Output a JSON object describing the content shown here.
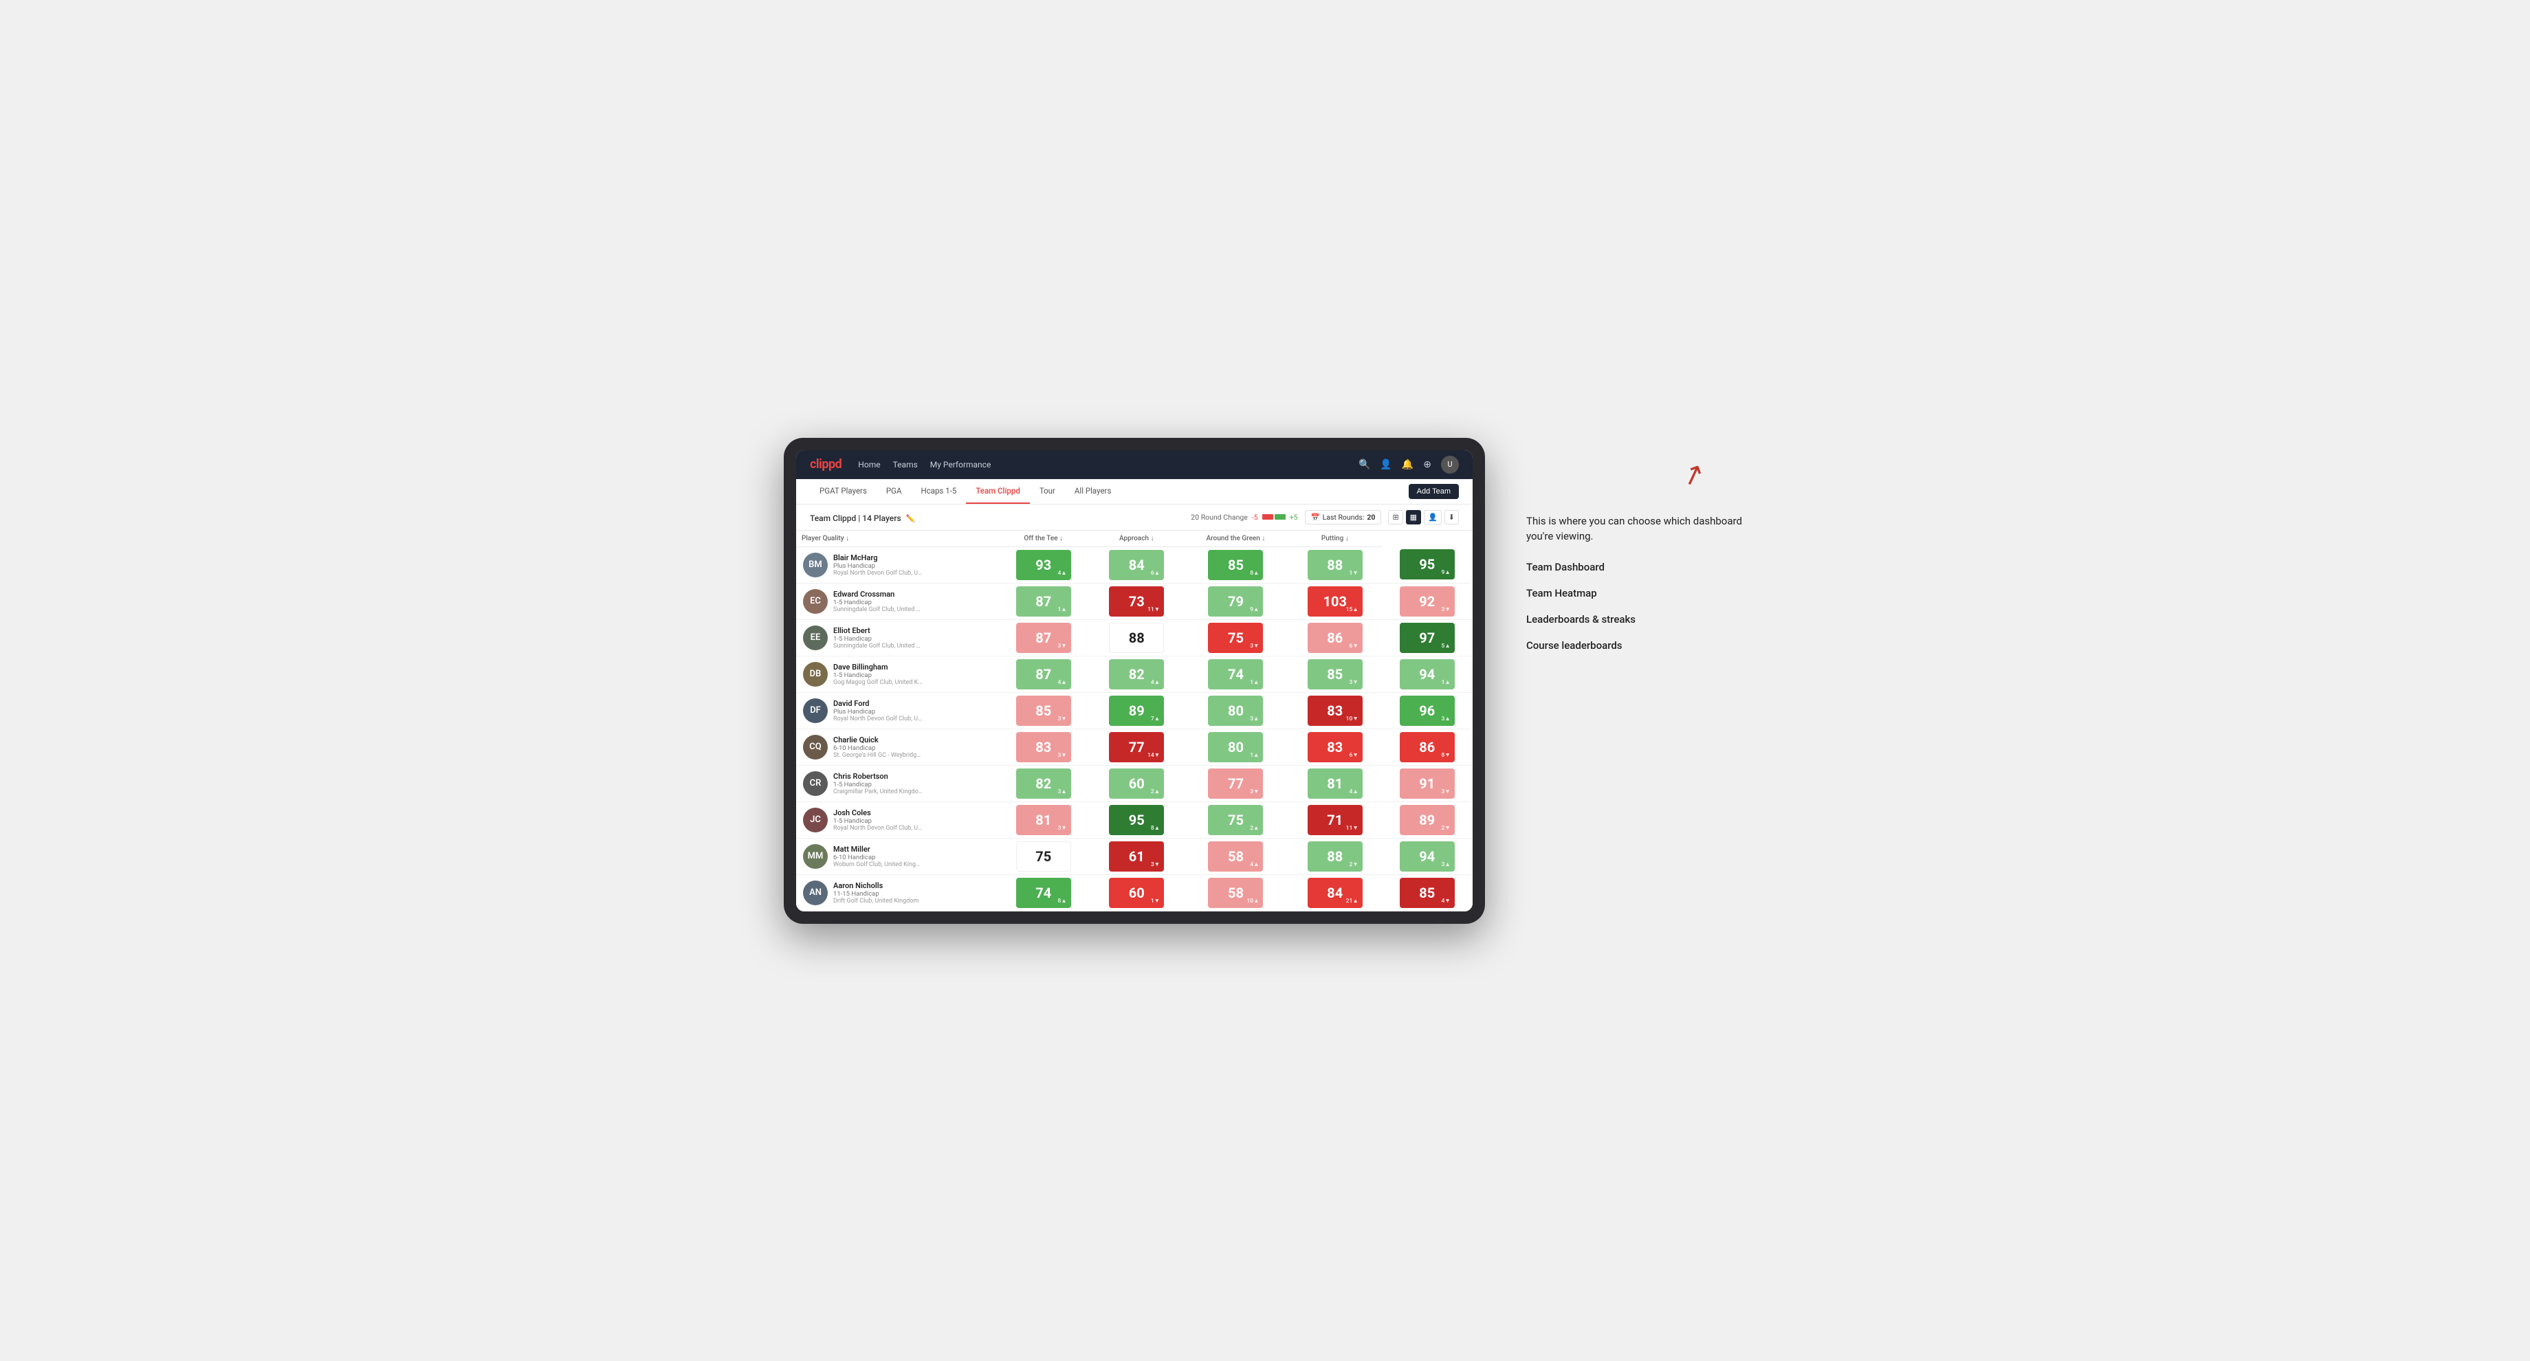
{
  "logo": "clippd",
  "nav": {
    "links": [
      "Home",
      "Teams",
      "My Performance"
    ],
    "icons": [
      "🔍",
      "👤",
      "🔔",
      "⊕",
      "👤"
    ]
  },
  "sub_nav": {
    "tabs": [
      {
        "label": "PGAT Players",
        "active": false
      },
      {
        "label": "PGA",
        "active": false
      },
      {
        "label": "Hcaps 1-5",
        "active": false
      },
      {
        "label": "Team Clippd",
        "active": true
      },
      {
        "label": "Tour",
        "active": false
      },
      {
        "label": "All Players",
        "active": false
      }
    ],
    "add_team_label": "Add Team"
  },
  "team_header": {
    "title": "Team Clippd",
    "player_count": "14 Players",
    "round_change_label": "20 Round Change",
    "change_neg": "-5",
    "change_pos": "+5",
    "last_rounds_label": "Last Rounds:",
    "last_rounds_value": "20"
  },
  "table": {
    "columns": [
      {
        "label": "Player Quality ↓",
        "key": "player_quality"
      },
      {
        "label": "Off the Tee ↓",
        "key": "off_tee"
      },
      {
        "label": "Approach ↓",
        "key": "approach"
      },
      {
        "label": "Around the Green ↓",
        "key": "around_green"
      },
      {
        "label": "Putting ↓",
        "key": "putting"
      }
    ],
    "rows": [
      {
        "name": "Blair McHarg",
        "handicap": "Plus Handicap",
        "club": "Royal North Devon Golf Club, United Kingdom",
        "avatar_color": "#6b7c8d",
        "avatar_initials": "BM",
        "scores": [
          {
            "value": "93",
            "change": "4▲",
            "change_dir": "up",
            "bg": "bg-green-mid"
          },
          {
            "value": "84",
            "change": "6▲",
            "change_dir": "up",
            "bg": "bg-green-light"
          },
          {
            "value": "85",
            "change": "8▲",
            "change_dir": "up",
            "bg": "bg-green-mid"
          },
          {
            "value": "88",
            "change": "1▼",
            "change_dir": "down",
            "bg": "bg-green-light"
          },
          {
            "value": "95",
            "change": "9▲",
            "change_dir": "up",
            "bg": "bg-green-dark"
          }
        ]
      },
      {
        "name": "Edward Crossman",
        "handicap": "1-5 Handicap",
        "club": "Sunningdale Golf Club, United Kingdom",
        "avatar_color": "#8b6b5d",
        "avatar_initials": "EC",
        "scores": [
          {
            "value": "87",
            "change": "1▲",
            "change_dir": "up",
            "bg": "bg-green-light"
          },
          {
            "value": "73",
            "change": "11▼",
            "change_dir": "down",
            "bg": "bg-red-dark"
          },
          {
            "value": "79",
            "change": "9▲",
            "change_dir": "up",
            "bg": "bg-green-light"
          },
          {
            "value": "103",
            "change": "15▲",
            "change_dir": "up",
            "bg": "bg-red-mid"
          },
          {
            "value": "92",
            "change": "3▼",
            "change_dir": "down",
            "bg": "bg-red-light"
          }
        ]
      },
      {
        "name": "Elliot Ebert",
        "handicap": "1-5 Handicap",
        "club": "Sunningdale Golf Club, United Kingdom",
        "avatar_color": "#5d6b5d",
        "avatar_initials": "EE",
        "scores": [
          {
            "value": "87",
            "change": "3▼",
            "change_dir": "down",
            "bg": "bg-red-light"
          },
          {
            "value": "88",
            "change": "",
            "change_dir": "",
            "bg": "bg-white"
          },
          {
            "value": "75",
            "change": "3▼",
            "change_dir": "down",
            "bg": "bg-red-mid"
          },
          {
            "value": "86",
            "change": "6▼",
            "change_dir": "down",
            "bg": "bg-red-light"
          },
          {
            "value": "97",
            "change": "5▲",
            "change_dir": "up",
            "bg": "bg-green-dark"
          }
        ]
      },
      {
        "name": "Dave Billingham",
        "handicap": "1-5 Handicap",
        "club": "Gog Magog Golf Club, United Kingdom",
        "avatar_color": "#7a6b4a",
        "avatar_initials": "DB",
        "scores": [
          {
            "value": "87",
            "change": "4▲",
            "change_dir": "up",
            "bg": "bg-green-light"
          },
          {
            "value": "82",
            "change": "4▲",
            "change_dir": "up",
            "bg": "bg-green-light"
          },
          {
            "value": "74",
            "change": "1▲",
            "change_dir": "up",
            "bg": "bg-green-light"
          },
          {
            "value": "85",
            "change": "3▼",
            "change_dir": "down",
            "bg": "bg-green-light"
          },
          {
            "value": "94",
            "change": "1▲",
            "change_dir": "up",
            "bg": "bg-green-light"
          }
        ]
      },
      {
        "name": "David Ford",
        "handicap": "Plus Handicap",
        "club": "Royal North Devon Golf Club, United Kingdom",
        "avatar_color": "#4a5a6a",
        "avatar_initials": "DF",
        "scores": [
          {
            "value": "85",
            "change": "3▼",
            "change_dir": "down",
            "bg": "bg-red-light"
          },
          {
            "value": "89",
            "change": "7▲",
            "change_dir": "up",
            "bg": "bg-green-mid"
          },
          {
            "value": "80",
            "change": "3▲",
            "change_dir": "up",
            "bg": "bg-green-light"
          },
          {
            "value": "83",
            "change": "10▼",
            "change_dir": "down",
            "bg": "bg-red-dark"
          },
          {
            "value": "96",
            "change": "3▲",
            "change_dir": "up",
            "bg": "bg-green-mid"
          }
        ]
      },
      {
        "name": "Charlie Quick",
        "handicap": "6-10 Handicap",
        "club": "St. George's Hill GC - Weybridge - Surrey, Uni...",
        "avatar_color": "#6a5a4a",
        "avatar_initials": "CQ",
        "scores": [
          {
            "value": "83",
            "change": "3▼",
            "change_dir": "down",
            "bg": "bg-red-light"
          },
          {
            "value": "77",
            "change": "14▼",
            "change_dir": "down",
            "bg": "bg-red-dark"
          },
          {
            "value": "80",
            "change": "1▲",
            "change_dir": "up",
            "bg": "bg-green-light"
          },
          {
            "value": "83",
            "change": "6▼",
            "change_dir": "down",
            "bg": "bg-red-mid"
          },
          {
            "value": "86",
            "change": "8▼",
            "change_dir": "down",
            "bg": "bg-red-mid"
          }
        ]
      },
      {
        "name": "Chris Robertson",
        "handicap": "1-5 Handicap",
        "club": "Craigmillar Park, United Kingdom",
        "avatar_color": "#5a5a5a",
        "avatar_initials": "CR",
        "scores": [
          {
            "value": "82",
            "change": "3▲",
            "change_dir": "up",
            "bg": "bg-green-light"
          },
          {
            "value": "60",
            "change": "2▲",
            "change_dir": "up",
            "bg": "bg-green-light"
          },
          {
            "value": "77",
            "change": "3▼",
            "change_dir": "down",
            "bg": "bg-red-light"
          },
          {
            "value": "81",
            "change": "4▲",
            "change_dir": "up",
            "bg": "bg-green-light"
          },
          {
            "value": "91",
            "change": "3▼",
            "change_dir": "down",
            "bg": "bg-red-light"
          }
        ]
      },
      {
        "name": "Josh Coles",
        "handicap": "1-5 Handicap",
        "club": "Royal North Devon Golf Club, United Kingdom",
        "avatar_color": "#7a4a4a",
        "avatar_initials": "JC",
        "scores": [
          {
            "value": "81",
            "change": "3▼",
            "change_dir": "down",
            "bg": "bg-red-light"
          },
          {
            "value": "95",
            "change": "8▲",
            "change_dir": "up",
            "bg": "bg-green-dark"
          },
          {
            "value": "75",
            "change": "2▲",
            "change_dir": "up",
            "bg": "bg-green-light"
          },
          {
            "value": "71",
            "change": "11▼",
            "change_dir": "down",
            "bg": "bg-red-dark"
          },
          {
            "value": "89",
            "change": "2▼",
            "change_dir": "down",
            "bg": "bg-red-light"
          }
        ]
      },
      {
        "name": "Matt Miller",
        "handicap": "6-10 Handicap",
        "club": "Woburn Golf Club, United Kingdom",
        "avatar_color": "#6a7a5a",
        "avatar_initials": "MM",
        "scores": [
          {
            "value": "75",
            "change": "",
            "change_dir": "",
            "bg": "bg-white"
          },
          {
            "value": "61",
            "change": "3▼",
            "change_dir": "down",
            "bg": "bg-red-dark"
          },
          {
            "value": "58",
            "change": "4▲",
            "change_dir": "up",
            "bg": "bg-red-light"
          },
          {
            "value": "88",
            "change": "2▼",
            "change_dir": "down",
            "bg": "bg-green-light"
          },
          {
            "value": "94",
            "change": "3▲",
            "change_dir": "up",
            "bg": "bg-green-light"
          }
        ]
      },
      {
        "name": "Aaron Nicholls",
        "handicap": "11-15 Handicap",
        "club": "Drift Golf Club, United Kingdom",
        "avatar_color": "#5a6a7a",
        "avatar_initials": "AN",
        "scores": [
          {
            "value": "74",
            "change": "8▲",
            "change_dir": "up",
            "bg": "bg-green-mid"
          },
          {
            "value": "60",
            "change": "1▼",
            "change_dir": "down",
            "bg": "bg-red-mid"
          },
          {
            "value": "58",
            "change": "10▲",
            "change_dir": "up",
            "bg": "bg-red-light"
          },
          {
            "value": "84",
            "change": "21▲",
            "change_dir": "up",
            "bg": "bg-red-mid"
          },
          {
            "value": "85",
            "change": "4▼",
            "change_dir": "down",
            "bg": "bg-red-dark"
          }
        ]
      }
    ]
  },
  "annotation": {
    "intro_text": "This is where you can choose which dashboard you're viewing.",
    "options": [
      "Team Dashboard",
      "Team Heatmap",
      "Leaderboards & streaks",
      "Course leaderboards"
    ]
  }
}
